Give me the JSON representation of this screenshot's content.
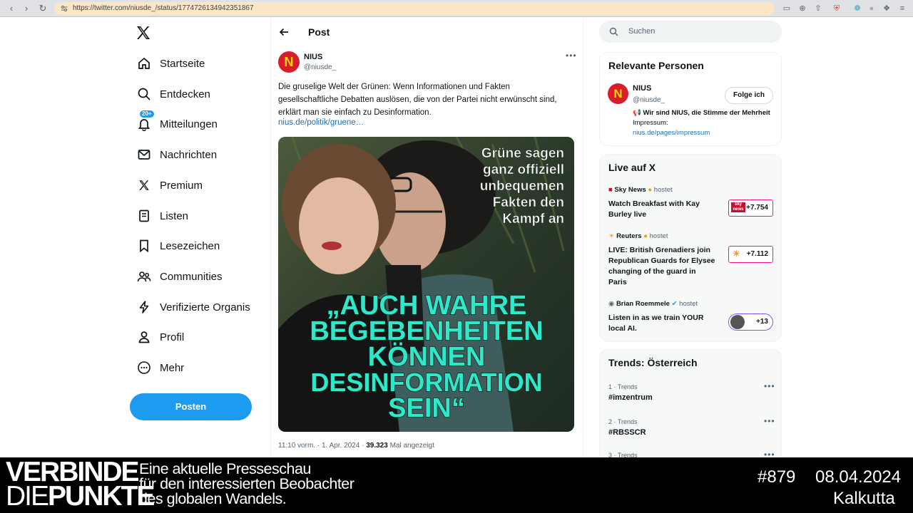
{
  "browser": {
    "url": "https://twitter.com/niusde_/status/1774726134942351867"
  },
  "nav": {
    "items": [
      {
        "label": "Startseite",
        "icon": "home-icon"
      },
      {
        "label": "Entdecken",
        "icon": "search-icon"
      },
      {
        "label": "Mitteilungen",
        "icon": "bell-icon",
        "badge": "20+"
      },
      {
        "label": "Nachrichten",
        "icon": "mail-icon"
      },
      {
        "label": "Premium",
        "icon": "x-logo-icon"
      },
      {
        "label": "Listen",
        "icon": "list-icon"
      },
      {
        "label": "Lesezeichen",
        "icon": "bookmark-icon"
      },
      {
        "label": "Communities",
        "icon": "people-icon"
      },
      {
        "label": "Verifizierte Organis",
        "icon": "lightning-icon"
      },
      {
        "label": "Profil",
        "icon": "person-icon"
      },
      {
        "label": "Mehr",
        "icon": "more-circle-icon"
      }
    ],
    "post_button": "Posten"
  },
  "post": {
    "header_title": "Post",
    "author_name": "NIUS",
    "author_handle": "@niusde_",
    "avatar_letter": "N",
    "text": "Die gruselige Welt der Grünen: Wenn Informationen und Fakten gesellschaftliche Debatten auslösen, die von der Partei nicht erwünscht sind, erklärt man sie einfach zu Desinformation.",
    "link": "nius.de/politik/gruene…",
    "image": {
      "headline_lines": [
        "Grüne sagen",
        "ganz offiziell",
        "unbequemen",
        "Fakten den",
        "Kampf an"
      ],
      "quote_lines": [
        "„AUCH WAHRE",
        "BEGEBENHEITEN",
        "KÖNNEN",
        "DESINFORMATION",
        "SEIN“"
      ]
    },
    "meta_time": "11:10 vorm. · 1. Apr. 2024 · ",
    "meta_views": "39.323",
    "meta_views_label": " Mal angezeigt"
  },
  "search": {
    "placeholder": "Suchen"
  },
  "relevant": {
    "title": "Relevante Personen",
    "name": "NIUS",
    "handle": "@niusde_",
    "follow": "Folge ich",
    "bio_bold": "📢 Wir sind NIUS, die Stimme der Mehrheit",
    "bio_rest": " Impressum:",
    "bio_link": "nius.de/pages/impressum"
  },
  "live": {
    "title": "Live auf X",
    "items": [
      {
        "host": "Sky News",
        "hosted": "hostet",
        "title": "Watch Breakfast with Kay Burley live",
        "count": "+7.754"
      },
      {
        "host": "Reuters",
        "hosted": "hostet",
        "title": "LIVE: British Grenadiers join Republican Guards for Elysee changing of the guard in Paris",
        "count": "+7.112"
      },
      {
        "host": "Brian Roemmele",
        "hosted": "hostet",
        "title": "Listen in as we train YOUR local AI.",
        "count": "+13"
      }
    ]
  },
  "trends": {
    "title": "Trends: Österreich",
    "items": [
      {
        "meta": "1 · Trends",
        "name": "#imzentrum"
      },
      {
        "meta": "2 · Trends",
        "name": "#RBSSCR"
      },
      {
        "meta": "3 · Trends",
        "name": ""
      }
    ]
  },
  "banner": {
    "brand_line1": "VERBINDE",
    "brand_line2_thin": "DIE",
    "brand_line2_bold": "PUNKTE",
    "tagline1": "Eine aktuelle Presseschau",
    "tagline2": "für den interessierten Beobachter",
    "tagline3": "des globalen Wandels.",
    "episode": "#879",
    "date": "08.04.2024",
    "city": "Kalkutta"
  }
}
